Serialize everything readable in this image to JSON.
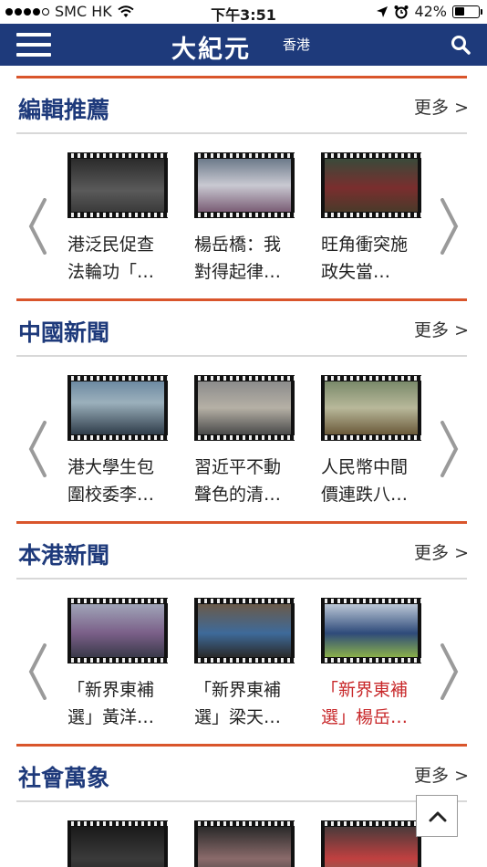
{
  "status_bar": {
    "carrier": "SMC HK",
    "time": "下午3:51",
    "battery": "42%",
    "battery_level": 0.42
  },
  "nav": {
    "logo": "大紀元",
    "region": "香港",
    "icons": [
      "menu-icon",
      "search-icon"
    ]
  },
  "sections": [
    {
      "title": "編輯推薦",
      "more": "更多 >",
      "cards": [
        {
          "line1": "港泛民促查",
          "line2": "法輪功「…",
          "highlight": false
        },
        {
          "line1": "楊岳橋：我",
          "line2": "對得起律…",
          "highlight": false
        },
        {
          "line1": "旺角衝突施",
          "line2": "政失當…",
          "highlight": false
        }
      ]
    },
    {
      "title": "中國新聞",
      "more": "更多 >",
      "cards": [
        {
          "line1": "港大學生包",
          "line2": "圍校委李…",
          "highlight": false
        },
        {
          "line1": "習近平不動",
          "line2": "聲色的清…",
          "highlight": false
        },
        {
          "line1": "人民幣中間",
          "line2": "價連跌八…",
          "highlight": false
        }
      ]
    },
    {
      "title": "本港新聞",
      "more": "更多 >",
      "cards": [
        {
          "line1": "「新界東補",
          "line2": "選」黃洋…",
          "highlight": false
        },
        {
          "line1": "「新界東補",
          "line2": "選」梁天…",
          "highlight": false
        },
        {
          "line1": "「新界東補",
          "line2": "選」楊岳…",
          "highlight": true
        }
      ]
    },
    {
      "title": "社會萬象",
      "more": "更多 >",
      "cards": []
    }
  ],
  "colors": {
    "nav_bg": "#1e3a7b",
    "accent_line": "#d9552b",
    "section_title": "#1e3a7b",
    "highlight_text": "#c8282a"
  }
}
